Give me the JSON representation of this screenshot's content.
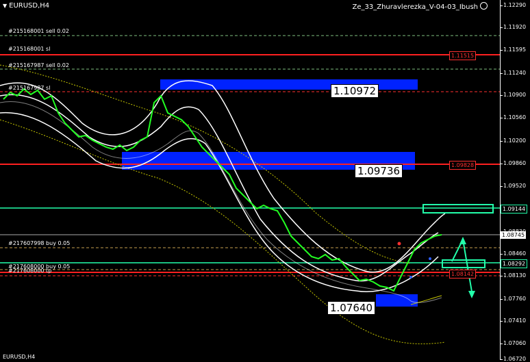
{
  "chart": {
    "symbol": "EURUSD,H4",
    "expert": "Ze_33_Zhuravlerezka_V-04-03_Ibush",
    "bottom_text": "EURUSD,H4"
  },
  "order_labels": [
    {
      "text": "#215168001 sell 0.02"
    },
    {
      "text": "#215168001 sl"
    },
    {
      "text": "#215167987 sell 0.02"
    },
    {
      "text": "#215167987 sl"
    },
    {
      "text": "#217607998 buy 0.05"
    },
    {
      "text": "#217608000 buy 0.05"
    },
    {
      "text": "#217608000 tp"
    }
  ],
  "annotations": [
    "1.10972",
    "1.09736",
    "1.07640"
  ],
  "axis_ticks": [
    "1.12290",
    "1.11920",
    "1.11595",
    "1.11240",
    "1.10900",
    "1.10560",
    "1.10200",
    "1.09860",
    "1.09520",
    "1.09180",
    "1.08830",
    "1.08460",
    "1.08130",
    "1.07760",
    "1.07410",
    "1.07060",
    "1.06720"
  ],
  "price_labels": [
    {
      "text": "1.11515",
      "color": "#ff3030",
      "bg": "#000000",
      "border": "#ff3030"
    },
    {
      "text": "1.09828",
      "color": "#ff3030",
      "bg": "#000000",
      "border": "#ff3030"
    },
    {
      "text": "1.09144",
      "color": "#ffffff",
      "bg": "#000000",
      "border": "#00ff88"
    },
    {
      "text": "1.08745",
      "color": "#000000",
      "bg": "#ffffff",
      "border": "#ffffff"
    },
    {
      "text": "1.08292",
      "color": "#ffffff",
      "bg": "#000000",
      "border": "#00ff88"
    },
    {
      "text": "1.08142",
      "color": "#ff3030",
      "bg": "#000000",
      "border": "#ff3030"
    }
  ],
  "colors": {
    "candles": "#22ff22",
    "bands": "#ffffff",
    "zones": "#0022ff",
    "stop_lines": "#ff2020",
    "level_lines": "#22ffaa",
    "ma_dotted": "#c8c800"
  }
}
